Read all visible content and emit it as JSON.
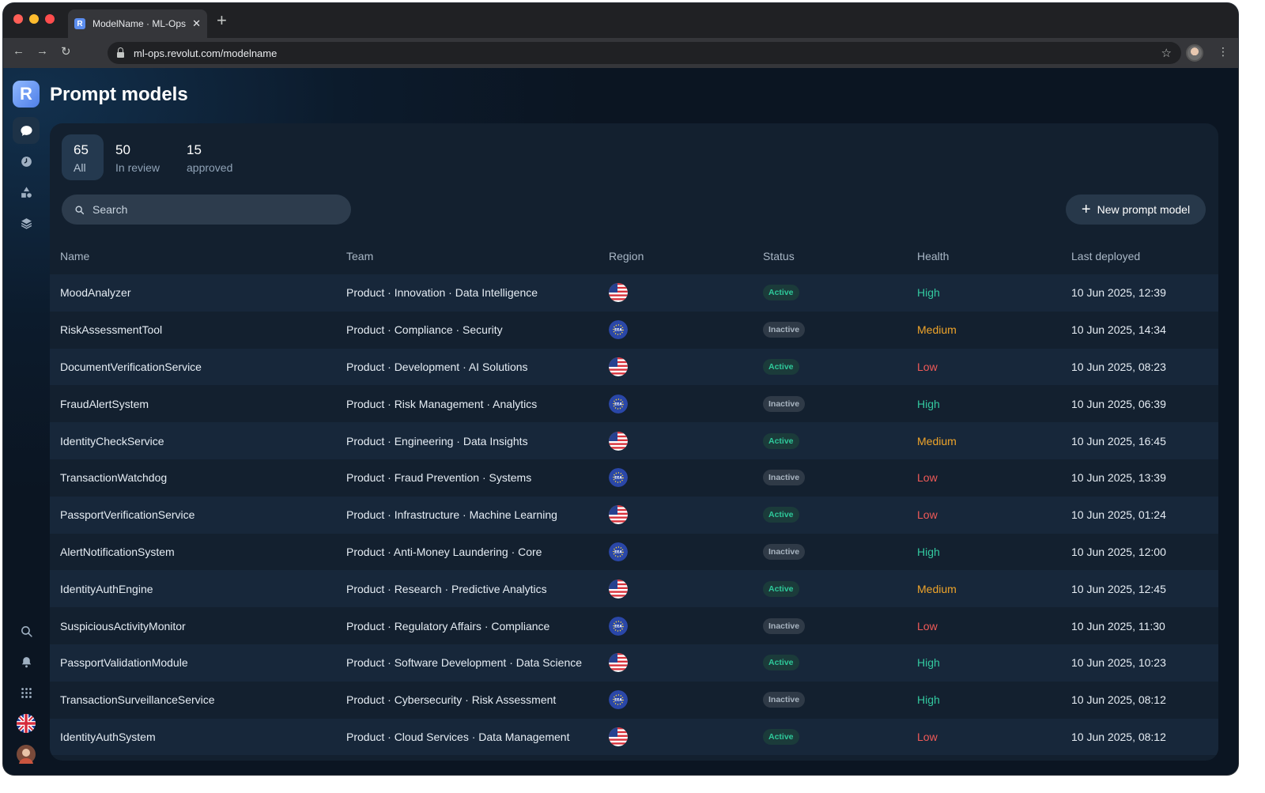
{
  "browser": {
    "tab_title": "ModelName · ML-Ops",
    "tab_favicon": "R",
    "url": "ml-ops.revolut.com/modelname"
  },
  "app": {
    "logo_letter": "R",
    "title": "Prompt models"
  },
  "sidebar": {
    "top_icons": [
      "chat-icon",
      "clock-icon",
      "shapes-icon",
      "layers-icon"
    ],
    "bottom_icons": [
      "search-icon",
      "bell-icon",
      "grid-icon",
      "uk-flag-icon",
      "user-avatar"
    ]
  },
  "stats": [
    {
      "value": "65",
      "label": "All",
      "active": true
    },
    {
      "value": "50",
      "label": "In review",
      "active": false
    },
    {
      "value": "15",
      "label": "approved",
      "active": false
    }
  ],
  "search": {
    "placeholder": "Search"
  },
  "new_button": {
    "label": "New prompt model"
  },
  "table": {
    "headers": {
      "name": "Name",
      "team": "Team",
      "region": "Region",
      "status": "Status",
      "health": "Health",
      "last_deployed": "Last deployed"
    },
    "rows": [
      {
        "name": "MoodAnalyzer",
        "team": "Product · Innovation · Data Intelligence",
        "region": "us",
        "status": "Active",
        "health": "High",
        "last_deployed": "10 Jun 2025, 12:39"
      },
      {
        "name": "RiskAssessmentTool",
        "team": "Product · Compliance · Security",
        "region": "eea",
        "status": "Inactive",
        "health": "Medium",
        "last_deployed": "10 Jun 2025, 14:34"
      },
      {
        "name": "DocumentVerificationService",
        "team": "Product · Development · AI Solutions",
        "region": "us",
        "status": "Active",
        "health": "Low",
        "last_deployed": "10 Jun 2025, 08:23"
      },
      {
        "name": "FraudAlertSystem",
        "team": "Product · Risk Management · Analytics",
        "region": "eea",
        "status": "Inactive",
        "health": "High",
        "last_deployed": "10 Jun 2025, 06:39"
      },
      {
        "name": "IdentityCheckService",
        "team": "Product · Engineering · Data Insights",
        "region": "us",
        "status": "Active",
        "health": "Medium",
        "last_deployed": "10 Jun 2025, 16:45"
      },
      {
        "name": "TransactionWatchdog",
        "team": "Product · Fraud Prevention · Systems",
        "region": "eea",
        "status": "Inactive",
        "health": "Low",
        "last_deployed": "10 Jun 2025, 13:39"
      },
      {
        "name": "PassportVerificationService",
        "team": "Product · Infrastructure · Machine Learning",
        "region": "us",
        "status": "Active",
        "health": "Low",
        "last_deployed": "10 Jun 2025, 01:24"
      },
      {
        "name": "AlertNotificationSystem",
        "team": "Product · Anti-Money Laundering · Core",
        "region": "eea",
        "status": "Inactive",
        "health": "High",
        "last_deployed": "10 Jun 2025, 12:00"
      },
      {
        "name": "IdentityAuthEngine",
        "team": "Product · Research · Predictive Analytics",
        "region": "us",
        "status": "Active",
        "health": "Medium",
        "last_deployed": "10 Jun 2025, 12:45"
      },
      {
        "name": "SuspiciousActivityMonitor",
        "team": "Product · Regulatory Affairs · Compliance",
        "region": "eea",
        "status": "Inactive",
        "health": "Low",
        "last_deployed": "10 Jun 2025, 11:30"
      },
      {
        "name": "PassportValidationModule",
        "team": "Product · Software Development · Data Science",
        "region": "us",
        "status": "Active",
        "health": "High",
        "last_deployed": "10 Jun 2025, 10:23"
      },
      {
        "name": "TransactionSurveillanceService",
        "team": "Product · Cybersecurity · Risk Assessment",
        "region": "eea",
        "status": "Inactive",
        "health": "High",
        "last_deployed": "10 Jun 2025, 08:12"
      },
      {
        "name": "IdentityAuthSystem",
        "team": "Product · Cloud Services · Data Management",
        "region": "us",
        "status": "Active",
        "health": "Low",
        "last_deployed": "10 Jun 2025, 08:12"
      }
    ]
  },
  "colors": {
    "health_high": "#33c9a0",
    "health_medium": "#f0a52a",
    "health_low": "#f05a58",
    "status_active": "#2ec99a",
    "background": "#0b1522"
  }
}
